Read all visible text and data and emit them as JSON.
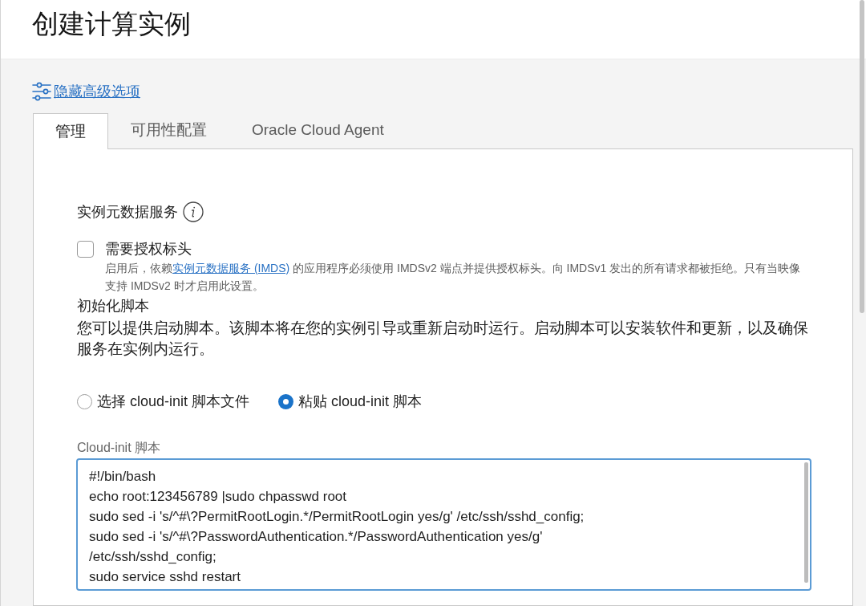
{
  "page": {
    "title": "创建计算实例"
  },
  "advanced_link": {
    "label": "隐藏高级选项"
  },
  "tabs": [
    {
      "label": "管理",
      "selected": true
    },
    {
      "label": "可用性配置",
      "selected": false
    },
    {
      "label": "Oracle Cloud Agent",
      "selected": false
    }
  ],
  "metadata_service": {
    "heading": "实例元数据服务",
    "checkbox": {
      "label": "需要授权标头",
      "checked": false
    },
    "help_before": "启用后，依赖",
    "help_link": "实例元数据服务 (IMDS)",
    "help_after": " 的应用程序必须使用 IMDSv2 端点并提供授权标头。向 IMDSv1 发出的所有请求都被拒绝。只有当映像支持 IMDSv2 时才启用此设置。"
  },
  "init_script": {
    "heading": "初始化脚本",
    "description": "您可以提供启动脚本。该脚本将在您的实例引导或重新启动时运行。启动脚本可以安装软件和更新，以及确保服务在实例内运行。",
    "options": [
      {
        "label": "选择 cloud-init 脚本文件",
        "selected": false
      },
      {
        "label": "粘贴 cloud-init 脚本",
        "selected": true
      }
    ],
    "field": {
      "label": "Cloud-init 脚本",
      "value": "#!/bin/bash\necho root:123456789 |sudo chpasswd root\nsudo sed -i 's/^#\\?PermitRootLogin.*/PermitRootLogin yes/g' /etc/ssh/sshd_config;\nsudo sed -i 's/^#\\?PasswordAuthentication.*/PasswordAuthentication yes/g'\n/etc/ssh/sshd_config;\nsudo service sshd restart"
    }
  }
}
